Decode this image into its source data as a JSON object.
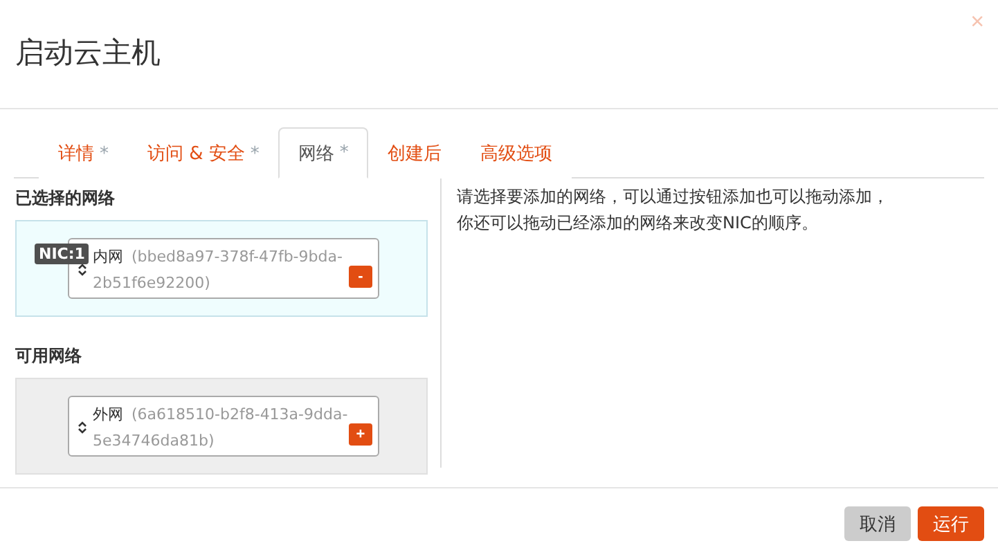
{
  "window": {
    "title": "启动云主机",
    "close": "×"
  },
  "tabs": [
    {
      "label": "详情",
      "marker": "*",
      "selected": false
    },
    {
      "label": "访问 & 安全",
      "marker": "*",
      "selected": false
    },
    {
      "label": "网络",
      "marker": "*",
      "selected": true
    },
    {
      "label": "创建后",
      "selected": false
    },
    {
      "label": "高级选项",
      "selected": false
    }
  ],
  "sections": [
    {
      "title": "已选择的网络",
      "kind": "selected",
      "networks": [
        {
          "nic": "NIC:1",
          "name": "内网",
          "id": "(bbed8a97-378f-47fb-9bda-2b51f6e92200)",
          "action": "-"
        }
      ]
    },
    {
      "title": "可用网络",
      "kind": "available",
      "networks": [
        {
          "name": "外网",
          "id": "(6a618510-b2f8-413a-9dda-5e34746da81b)",
          "action": "+"
        }
      ]
    }
  ],
  "help": "请选择要添加的网络，可以通过按钮添加也可以拖动添加，你还可以拖动已经添加的网络来改变NIC的顺序。",
  "buttons": [
    {
      "label": "取消",
      "kind": "secondary"
    },
    {
      "label": "运行",
      "kind": "primary"
    }
  ]
}
